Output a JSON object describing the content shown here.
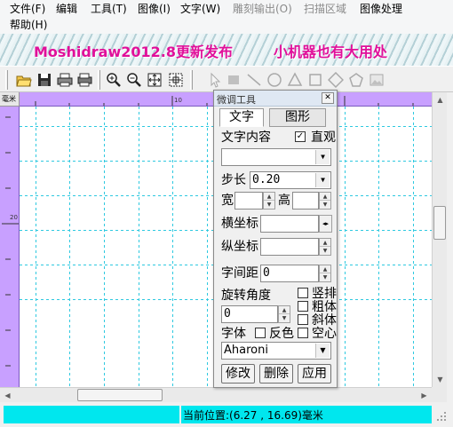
{
  "menu": {
    "file": "文件(F)",
    "edit": "编辑",
    "tools": "工具(T)",
    "image": "图像(I)",
    "text": "文字(W)",
    "engrave": "雕刻输出(O)",
    "scan": "扫描区域",
    "image_process": "图像处理",
    "help": "帮助(H)"
  },
  "banner": {
    "left": "Moshidraw2012.8更新发布",
    "right": "小机器也有大用处"
  },
  "toolbar": {
    "icons": [
      "open-folder-icon",
      "save-icon",
      "print-icon",
      "print-preview-icon",
      "zoom-in-icon",
      "zoom-out-icon",
      "fit-page-icon",
      "fit-selection-icon",
      "select-arrow-icon",
      "rectangle-icon",
      "line-icon",
      "circle-icon",
      "triangle-icon",
      "square-icon",
      "diamond-icon",
      "pentagon-icon",
      "image-icon"
    ]
  },
  "ruler": {
    "unit": "毫米",
    "h_label": "10",
    "v_label": "20"
  },
  "status": {
    "position": "当前位置:(6.27 , 16.69)毫米"
  },
  "panel": {
    "title": "微调工具",
    "tab_text": "文字",
    "tab_shape": "图形",
    "text_content_label": "文字内容",
    "intuitive_label": "直观",
    "intuitive_checked": true,
    "text_content_value": "",
    "step_label": "步长",
    "step_value": "0.20",
    "width_label": "宽",
    "height_label": "高",
    "hpos_label": "横坐标",
    "vpos_label": "纵坐标",
    "spacing_label": "字间距",
    "spacing_value": "0",
    "rotate_label": "旋转角度",
    "rotate_value": "0",
    "vertical_label": "竖排",
    "bold_label": "粗体",
    "italic_label": "斜体",
    "font_label": "字体",
    "invert_label": "反色",
    "hollow_label": "空心",
    "font_value": "Aharoni",
    "modify_button": "修改",
    "delete_button": "删除",
    "apply_button": "应用"
  }
}
